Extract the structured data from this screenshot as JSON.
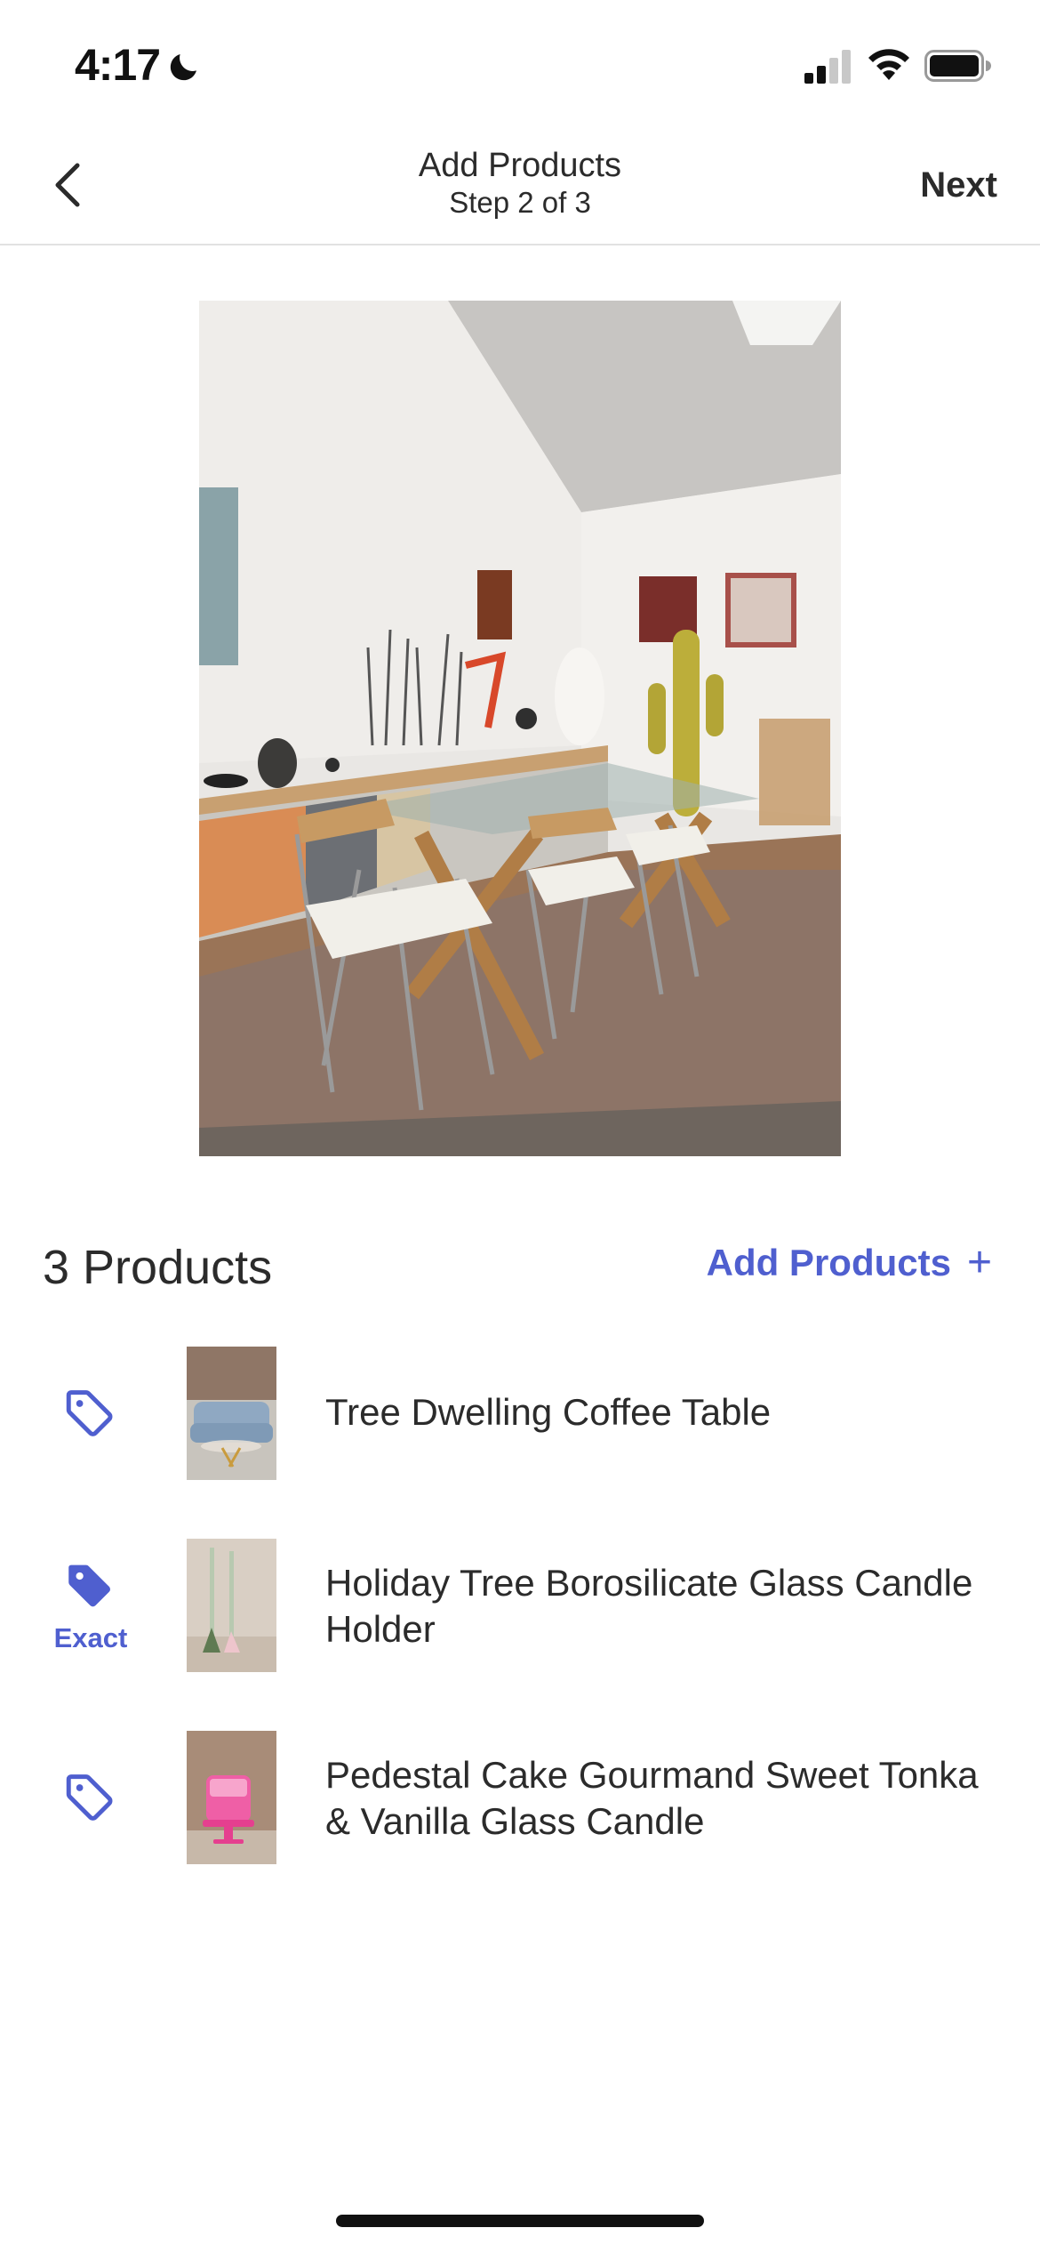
{
  "status_bar": {
    "time": "4:17",
    "icons": [
      "moon-icon",
      "signal-icon",
      "wifi-icon",
      "battery-icon"
    ]
  },
  "nav": {
    "title": "Add Products",
    "subtitle": "Step 2 of 3",
    "next_label": "Next",
    "back_icon": "chevron-left-icon"
  },
  "photo": {
    "subject": "dining-room-photo"
  },
  "products": {
    "count_label": "3 Products",
    "add_label": "Add Products",
    "add_icon": "+",
    "accent_color": "#4f5fcf",
    "items": [
      {
        "name": "Tree Dwelling Coffee Table",
        "tag_state": "outline",
        "tag_label": ""
      },
      {
        "name": "Holiday Tree Borosilicate Glass Candle Holder",
        "tag_state": "filled",
        "tag_label": "Exact"
      },
      {
        "name": "Pedestal Cake Gourmand Sweet Tonka & Vanilla Glass Candle",
        "tag_state": "outline",
        "tag_label": ""
      }
    ]
  }
}
